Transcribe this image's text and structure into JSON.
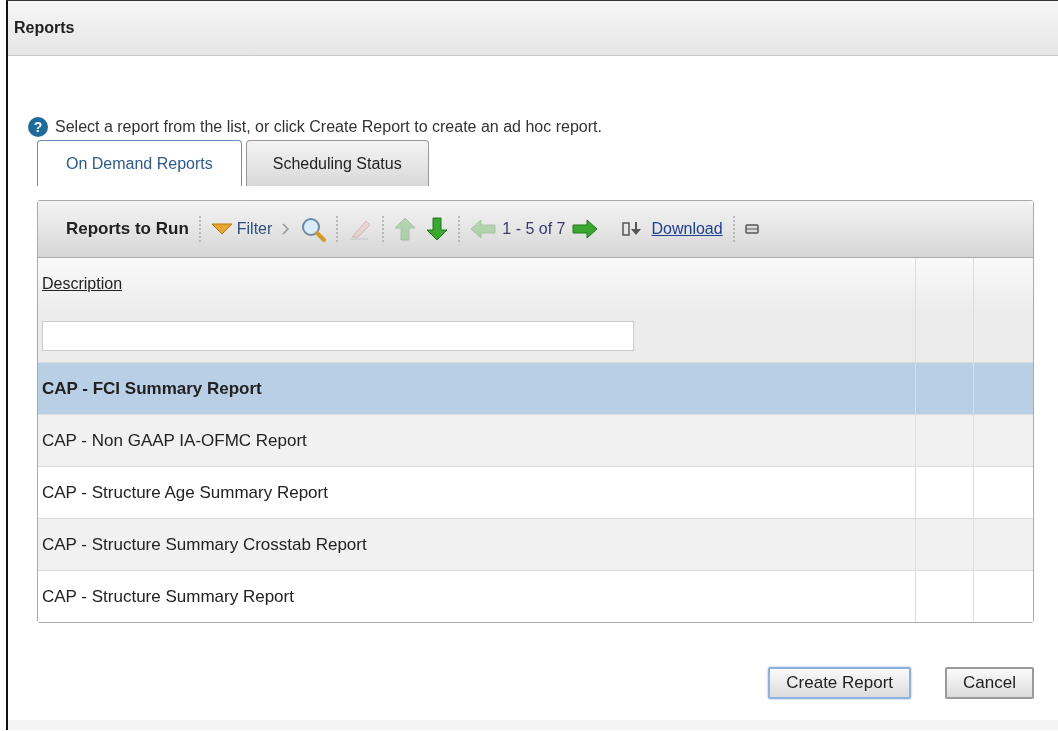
{
  "window": {
    "title": "Reports"
  },
  "help_icon": "?",
  "help_text": "Select a report from the list, or click Create Report to create an ad hoc report.",
  "tabs": [
    {
      "label": "On Demand Reports",
      "selected": true
    },
    {
      "label": "Scheduling Status",
      "selected": false
    }
  ],
  "toolbar": {
    "title": "Reports to Run",
    "filter_label": "Filter",
    "clear_disabled": true,
    "move_up_disabled": true,
    "move_down_disabled": false,
    "previous_disabled": true,
    "next_disabled": false,
    "page_info": "1 - 5 of 7",
    "download_label": "Download"
  },
  "table": {
    "columns": [
      "Description"
    ],
    "rows": [
      {
        "description": "CAP - FCI Summary Report",
        "selected": true
      },
      {
        "description": "CAP - Non GAAP IA-OFMC Report",
        "selected": false
      },
      {
        "description": "CAP - Structure Age Summary Report",
        "selected": false
      },
      {
        "description": "CAP - Structure Summary Crosstab Report",
        "selected": false
      },
      {
        "description": "CAP - Structure Summary Report",
        "selected": false
      }
    ]
  },
  "buttons": [
    {
      "label": "Create Report",
      "kind": "primary"
    },
    {
      "label": "Cancel",
      "kind": "secondary"
    }
  ]
}
